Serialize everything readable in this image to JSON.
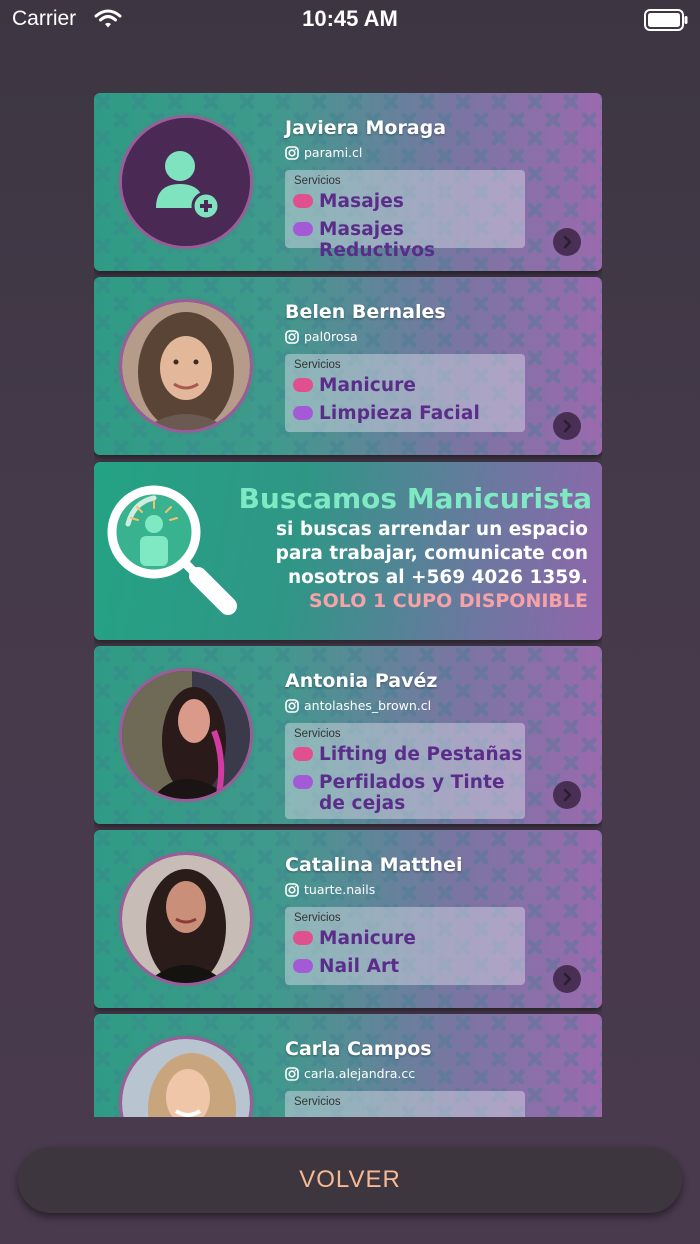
{
  "status_bar": {
    "carrier": "Carrier",
    "time": "10:45 AM"
  },
  "colors": {
    "accent_green": "#7fe9c3",
    "cta_pink": "#f5a3a8",
    "service_text": "#5b2d8a",
    "button_text": "#f7b995",
    "dot_pink": "#e0508f",
    "dot_purple": "#a45ad6"
  },
  "professionals": [
    {
      "name": "Javiera Moraga",
      "instagram": "parami.cl",
      "services_label": "Servicios",
      "services": [
        "Masajes",
        "Masajes Reductivos"
      ],
      "avatar": "add-user-placeholder-icon"
    },
    {
      "name": "Belen Bernales",
      "instagram": "pal0rosa",
      "services_label": "Servicios",
      "services": [
        "Manicure",
        "Limpieza Facial"
      ],
      "avatar": "profile-photo"
    },
    {
      "name": "Antonia Pavéz",
      "instagram": "antolashes_brown.cl",
      "services_label": "Servicios",
      "services": [
        "Lifting de Pestañas",
        "Perfilados y Tinte de cejas"
      ],
      "avatar": "profile-photo"
    },
    {
      "name": "Catalina Matthei",
      "instagram": "tuarte.nails",
      "services_label": "Servicios",
      "services": [
        "Manicure",
        "Nail Art"
      ],
      "avatar": "profile-photo"
    },
    {
      "name": "Carla Campos",
      "instagram": "carla.alejandra.cc",
      "services_label": "Servicios",
      "services": [],
      "avatar": "profile-photo"
    }
  ],
  "promo": {
    "title": "Buscamos Manicurista",
    "text": "si buscas arrendar un espacio para trabajar, comunicate con nosotros al +569 4026 1359.",
    "cta": "SOLO 1 CUPO DISPONIBLE"
  },
  "back_button": {
    "label": "VOLVER"
  }
}
